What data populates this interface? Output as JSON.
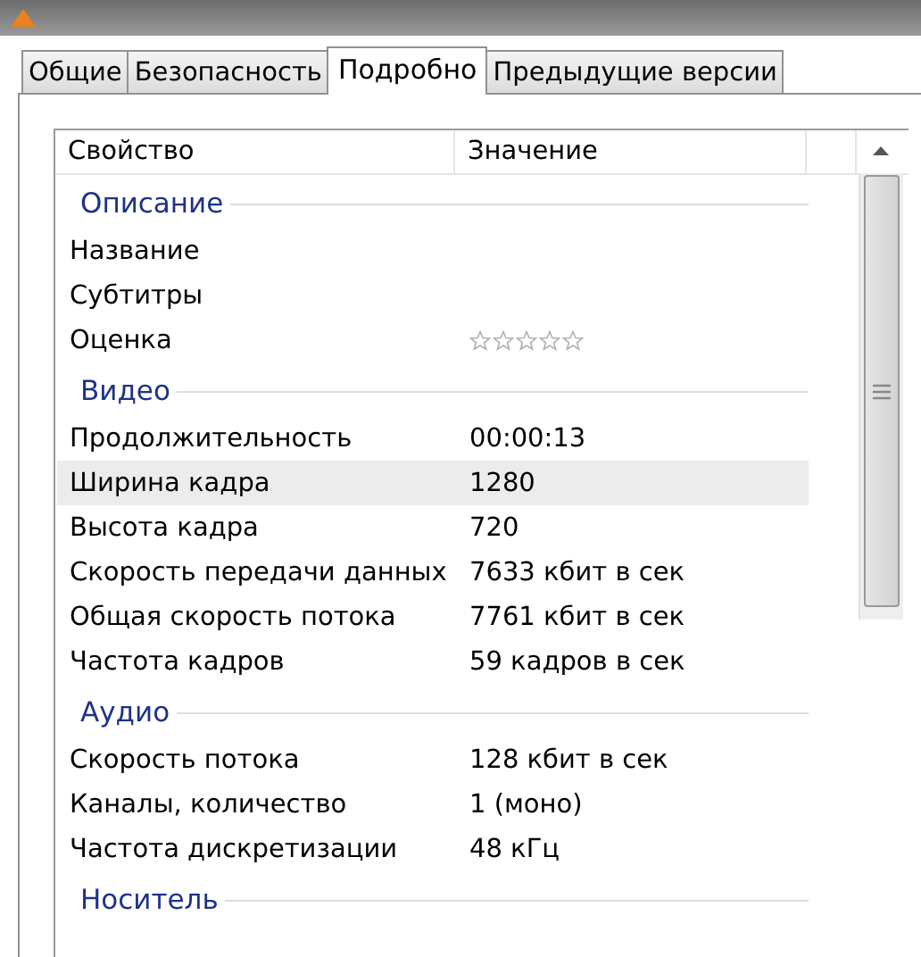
{
  "tabs": [
    {
      "label": "Общие",
      "selected": false
    },
    {
      "label": "Безопасность",
      "selected": false
    },
    {
      "label": "Подробно",
      "selected": true
    },
    {
      "label": "Предыдущие версии",
      "selected": false
    }
  ],
  "table": {
    "columns": [
      "Свойство",
      "Значение"
    ],
    "groups": [
      {
        "title": "Описание",
        "rows": [
          {
            "kind": "text",
            "name": "Название",
            "selected": false
          },
          {
            "kind": "text",
            "name": "Субтитры",
            "selected": false
          },
          {
            "kind": "rating",
            "name": "Оценка",
            "stars": 0,
            "selected": false
          }
        ]
      },
      {
        "title": "Видео",
        "rows": [
          {
            "kind": "text",
            "name": "Продолжительность",
            "value": "00:00:13",
            "selected": false
          },
          {
            "kind": "text",
            "name": "Ширина кадра",
            "value": "1280",
            "selected": true
          },
          {
            "kind": "text",
            "name": "Высота кадра",
            "value": "720",
            "selected": false
          },
          {
            "kind": "text",
            "name": "Скорость передачи данных",
            "value": "7633 кбит в сек",
            "selected": false
          },
          {
            "kind": "text",
            "name": "Общая скорость потока",
            "value": "7761 кбит в сек",
            "selected": false
          },
          {
            "kind": "text",
            "name": "Частота кадров",
            "value": "59 кадров в сек",
            "selected": false
          }
        ]
      },
      {
        "title": "Аудио",
        "rows": [
          {
            "kind": "text",
            "name": "Скорость потока",
            "value": "128 кбит в сек",
            "selected": false
          },
          {
            "kind": "text",
            "name": "Каналы, количество",
            "value": "1 (моно)",
            "selected": false
          },
          {
            "kind": "text",
            "name": "Частота дискретизации",
            "value": "48 кГц",
            "selected": false
          }
        ]
      },
      {
        "title": "Носитель"
      }
    ]
  }
}
